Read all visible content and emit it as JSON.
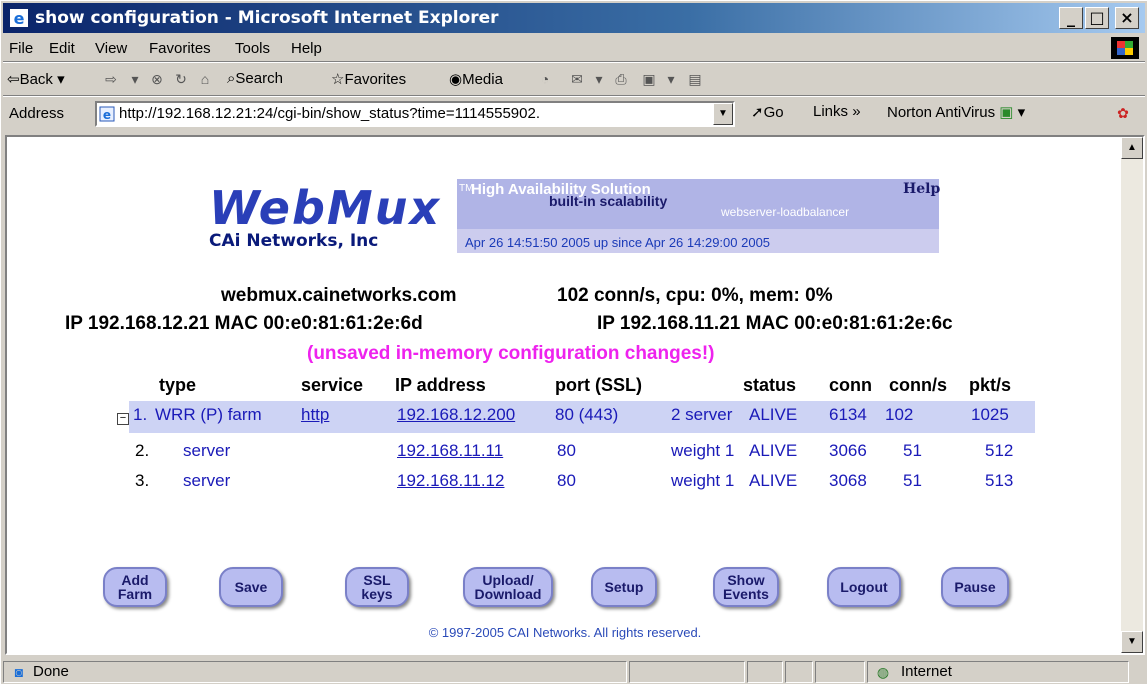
{
  "window": {
    "title": "show configuration - Microsoft Internet Explorer"
  },
  "menu": {
    "items": [
      "File",
      "Edit",
      "View",
      "Favorites",
      "Tools",
      "Help"
    ]
  },
  "toolbar": {
    "back": "Back",
    "search": "Search",
    "favorites": "Favorites",
    "media": "Media"
  },
  "address": {
    "label": "Address",
    "url": "http://192.168.12.21:24/cgi-bin/show_status?time=1114555902.",
    "go": "Go",
    "links": "Links",
    "norton": "Norton AntiVirus"
  },
  "banner": {
    "wordmark": "WebMux",
    "tm": "TM",
    "company": "CAi Networks, Inc",
    "tagline1": "High Availability Solution",
    "tagline2": "built-in scalability",
    "tagline3": "webserver-loadbalancer",
    "help": "Help",
    "timestamp": "Apr 26 14:51:50 2005 up since Apr 26 14:29:00 2005"
  },
  "host": {
    "name": "webmux.cainetworks.com",
    "stats": "102 conn/s, cpu: 0%, mem: 0%",
    "ip1": "IP 192.168.12.21  MAC 00:e0:81:61:2e:6d",
    "ip2": "IP 192.168.11.21  MAC 00:e0:81:61:2e:6c",
    "warning": "(unsaved in-memory configuration changes!)"
  },
  "table": {
    "headers": {
      "type": "type",
      "service": "service",
      "ip": "IP address",
      "port": "port (SSL)",
      "status": "status",
      "conn": "conn",
      "conns": "conn/s",
      "pkts": "pkt/s"
    },
    "rows": [
      {
        "idx": "1.",
        "type": "WRR (P) farm",
        "service": "http",
        "ip": "192.168.12.200",
        "port": "80 (443)",
        "extra": "2 server",
        "status": "ALIVE",
        "conn": "6134",
        "conns": "102",
        "pkts": "1025"
      },
      {
        "idx": "2.",
        "type": "server",
        "service": "",
        "ip": "192.168.11.11",
        "port": "80",
        "extra": "weight 1",
        "status": "ALIVE",
        "conn": "3066",
        "conns": "51",
        "pkts": "512"
      },
      {
        "idx": "3.",
        "type": "server",
        "service": "",
        "ip": "192.168.11.12",
        "port": "80",
        "extra": "weight 1",
        "status": "ALIVE",
        "conn": "3068",
        "conns": "51",
        "pkts": "513"
      }
    ]
  },
  "buttons": {
    "add_farm": "Add Farm",
    "save": "Save",
    "ssl_keys": "SSL keys",
    "upload": "Upload/ Download",
    "setup": "Setup",
    "show_events": "Show Events",
    "logout": "Logout",
    "pause": "Pause"
  },
  "copyright": "© 1997-2005 CAI Networks. All rights reserved.",
  "status": {
    "text": "Done",
    "zone": "Internet"
  }
}
